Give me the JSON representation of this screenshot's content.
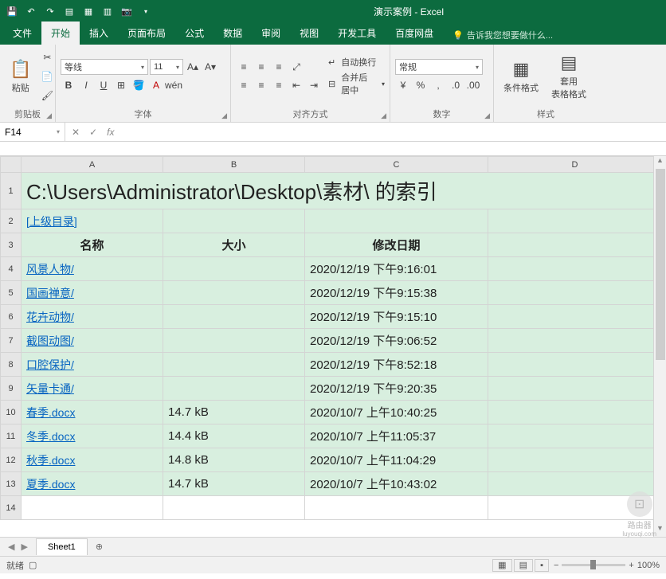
{
  "app": {
    "title": "演示案例 - Excel"
  },
  "qat": [
    "save-icon",
    "undo-icon",
    "redo-icon",
    "preview-icon",
    "print-icon",
    "new-icon",
    "camera-icon"
  ],
  "tabs": {
    "items": [
      "文件",
      "开始",
      "插入",
      "页面布局",
      "公式",
      "数据",
      "审阅",
      "视图",
      "开发工具",
      "百度网盘"
    ],
    "active": "开始",
    "tell": "告诉我您想要做什么..."
  },
  "ribbon": {
    "clipboard": {
      "label": "剪贴板",
      "paste": "粘贴"
    },
    "font": {
      "label": "字体",
      "name": "等线",
      "size": "11",
      "bold": "B",
      "italic": "I",
      "underline": "U"
    },
    "align": {
      "label": "对齐方式",
      "wrap": "自动换行",
      "merge": "合并后居中"
    },
    "number": {
      "label": "数字",
      "format": "常规"
    },
    "styles": {
      "label": "样式",
      "cond": "条件格式",
      "table": "套用\n表格格式"
    }
  },
  "namebox": "F14",
  "formula": "",
  "columns": [
    "A",
    "B",
    "C",
    "D"
  ],
  "heading_row": {
    "a": "C:\\Users\\Administrator\\Desktop\\素材\\ 的索引"
  },
  "up_link": "[上级目录]",
  "table_header": {
    "name": "名称",
    "size": "大小",
    "date": "修改日期"
  },
  "rows": [
    {
      "name": "风景人物/",
      "size": "",
      "date": "2020/12/19 下午9:16:01",
      "link": true
    },
    {
      "name": "国画禅意/",
      "size": "",
      "date": "2020/12/19 下午9:15:38",
      "link": true
    },
    {
      "name": "花卉动物/",
      "size": "",
      "date": "2020/12/19 下午9:15:10",
      "link": true
    },
    {
      "name": "截图动图/",
      "size": "",
      "date": "2020/12/19 下午9:06:52",
      "link": true
    },
    {
      "name": "口腔保护/",
      "size": "",
      "date": "2020/12/19 下午8:52:18",
      "link": true
    },
    {
      "name": "矢量卡通/",
      "size": "",
      "date": "2020/12/19 下午9:20:35",
      "link": true
    },
    {
      "name": "春季.docx",
      "size": "14.7 kB",
      "date": "2020/10/7 上午10:40:25",
      "link": true
    },
    {
      "name": "冬季.docx",
      "size": "14.4 kB",
      "date": "2020/10/7 上午11:05:37",
      "link": true
    },
    {
      "name": "秋季.docx",
      "size": "14.8 kB",
      "date": "2020/10/7 上午11:04:29",
      "link": true
    },
    {
      "name": "夏季.docx",
      "size": "14.7 kB",
      "date": "2020/10/7 上午10:43:02",
      "link": true
    }
  ],
  "sheet_tab": "Sheet1",
  "status": {
    "ready": "就绪",
    "rec": "",
    "zoom": "100%"
  },
  "watermark": {
    "text": "路由器",
    "sub": "luyouqi.com"
  }
}
